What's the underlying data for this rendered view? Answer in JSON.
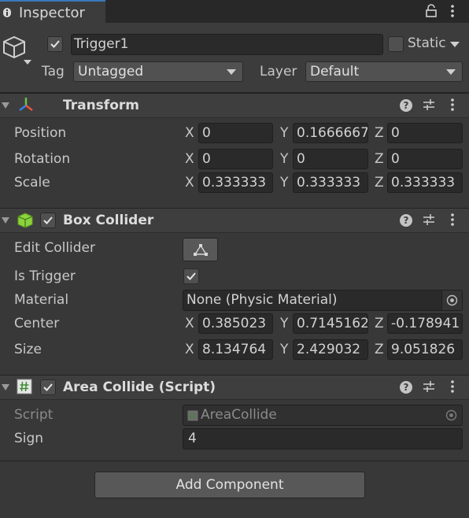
{
  "tab": {
    "label": "Inspector",
    "icon": "info-icon"
  },
  "header": {
    "object_name": "Trigger1",
    "active": true,
    "static_label": "Static",
    "tag_label": "Tag",
    "tag_value": "Untagged",
    "layer_label": "Layer",
    "layer_value": "Default"
  },
  "transform": {
    "title": "Transform",
    "rows": [
      {
        "label": "Position",
        "x": "0",
        "y": "0.1666667",
        "z": "0"
      },
      {
        "label": "Rotation",
        "x": "0",
        "y": "0",
        "z": "0"
      },
      {
        "label": "Scale",
        "x": "0.333333",
        "y": "0.333333",
        "z": "0.333333"
      }
    ]
  },
  "box_collider": {
    "title": "Box Collider",
    "enabled": true,
    "edit_collider_label": "Edit Collider",
    "is_trigger_label": "Is Trigger",
    "is_trigger": true,
    "material_label": "Material",
    "material_value": "None (Physic Material)",
    "center": {
      "label": "Center",
      "x": "0.385023",
      "y": "0.7145162",
      "z": "-0.178941"
    },
    "size": {
      "label": "Size",
      "x": "8.134764",
      "y": "2.429032",
      "z": "9.051826"
    }
  },
  "area_collide": {
    "title": "Area Collide (Script)",
    "enabled": true,
    "script_label": "Script",
    "script_value": "AreaCollide",
    "sign_label": "Sign",
    "sign_value": "4"
  },
  "axes": {
    "x": "X",
    "y": "Y",
    "z": "Z"
  },
  "add_component_label": "Add Component",
  "colors": {
    "accent": "#3a79bb",
    "background": "#383838",
    "field": "#2a2a2a",
    "collider_icon": "#8cd23c"
  }
}
